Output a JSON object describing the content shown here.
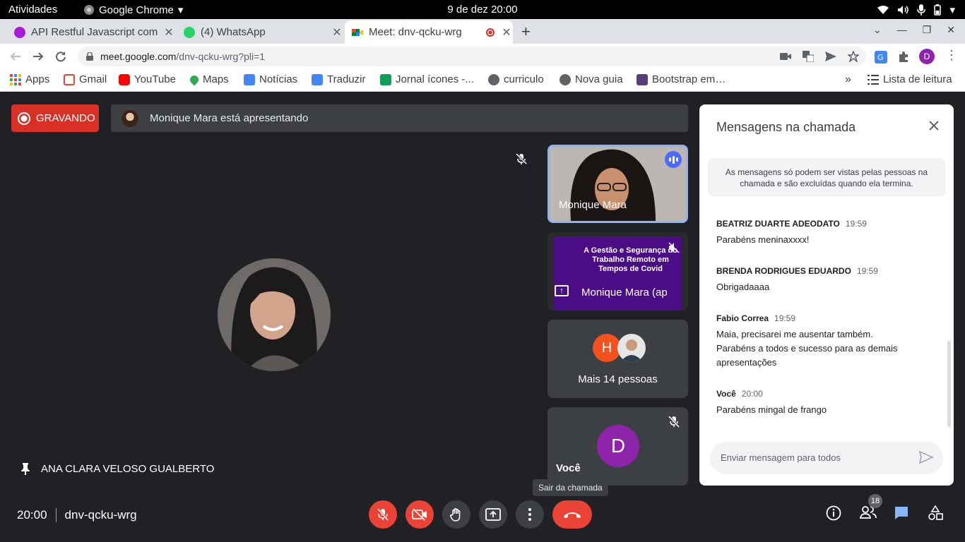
{
  "system_bar": {
    "activities": "Atividades",
    "app_name": "Google Chrome",
    "clock": "9 de dez  20:00"
  },
  "tabs": [
    {
      "title": "API Restful Javascript com",
      "color": "#a61bd6"
    },
    {
      "title": "(4) WhatsApp",
      "color": "#25d366"
    },
    {
      "title": "Meet: dnv-qcku-wrg",
      "color": "#00897b"
    }
  ],
  "address": {
    "host": "meet.google.com",
    "path": "/dnv-qcku-wrg?pli=1"
  },
  "profile_initial": "D",
  "bookmarks": [
    {
      "label": "Apps",
      "icon": "apps-grid-icon"
    },
    {
      "label": "Gmail",
      "icon": "gmail-icon"
    },
    {
      "label": "YouTube",
      "icon": "youtube-icon"
    },
    {
      "label": "Maps",
      "icon": "maps-icon"
    },
    {
      "label": "Notícias",
      "icon": "news-icon"
    },
    {
      "label": "Traduzir",
      "icon": "translate-icon"
    },
    {
      "label": "Jornal ícones -...",
      "icon": "jornal-icon"
    },
    {
      "label": "curriculo",
      "icon": "globe-icon"
    },
    {
      "label": "Nova guia",
      "icon": "globe-icon"
    },
    {
      "label": "Bootstrap em…",
      "icon": "bootstrap-icon"
    }
  ],
  "reading_list": "Lista de leitura",
  "meet": {
    "recording": "GRAVANDO",
    "presenting": "Monique Mara está apresentando",
    "main_participant": "ANA CLARA VELOSO GUALBERTO",
    "tiles": {
      "t1_name": "Monique Mara",
      "t2_name": "Monique Mara (ap",
      "t2_slide": "A Gestão e Segurança do Trabalho Remoto em Tempos de Covid",
      "t3_initial": "H",
      "t3_label": "Mais 14 pessoas",
      "t4_initial": "D",
      "t4_name": "Você"
    },
    "tooltip": "Sair da chamada",
    "time": "20:00",
    "meeting_code": "dnv-qcku-wrg",
    "participants_count": "18"
  },
  "chat": {
    "title": "Mensagens na chamada",
    "notice": "As mensagens só podem ser vistas pelas pessoas na chamada e são excluídas quando ela termina.",
    "messages": [
      {
        "sender": "BEATRIZ DUARTE ADEODATO",
        "time": "19:59",
        "text": "Parabéns meninaxxxx!"
      },
      {
        "sender": "BRENDA RODRIGUES EDUARDO",
        "time": "19:59",
        "text": "Obrigadaaaa"
      },
      {
        "sender": "Fabio Correa",
        "time": "19:59",
        "text": "Maia, precisarei me ausentar também. Parabéns a todos e sucesso para as demais apresentações"
      },
      {
        "sender": "Você",
        "time": "20:00",
        "text": "Parabéns mingal de frango"
      }
    ],
    "input_placeholder": "Enviar mensagem para todos"
  },
  "colors": {
    "accent_red": "#ea4335",
    "recording_red": "#d93025",
    "active_speaker": "#8ab4f8",
    "chat_icon": "#8ab4f8",
    "avatar_purple": "#8e24aa",
    "avatar_orange": "#f4511e"
  }
}
